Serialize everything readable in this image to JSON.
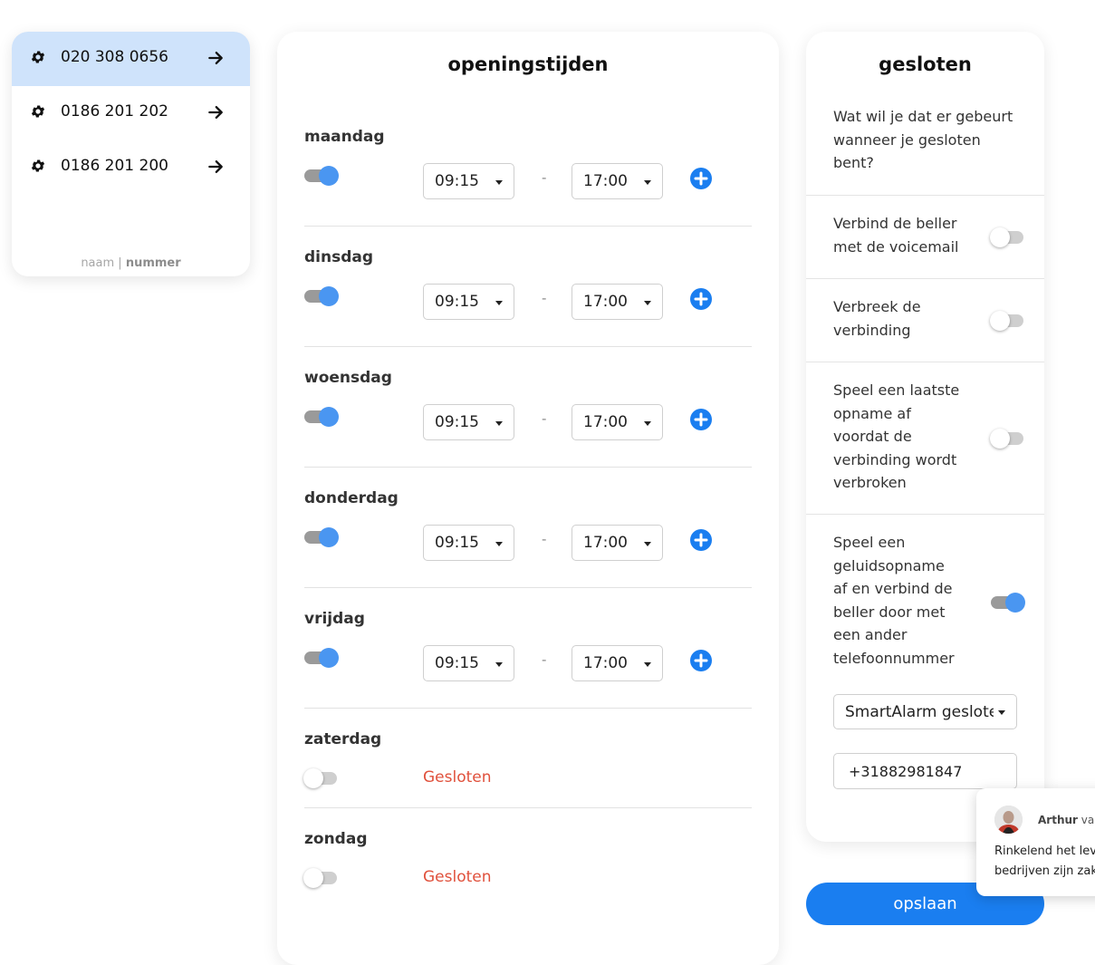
{
  "numbers": {
    "items": [
      {
        "number": "020 308 0656",
        "active": true
      },
      {
        "number": "0186 201 202",
        "active": false
      },
      {
        "number": "0186 201 200",
        "active": false
      }
    ],
    "sort_name": "naam",
    "sort_separator": "|",
    "sort_number": "nummer"
  },
  "hours": {
    "title": "openingstijden",
    "days": [
      {
        "name": "maandag",
        "open": true,
        "from": "09:15",
        "to": "17:00"
      },
      {
        "name": "dinsdag",
        "open": true,
        "from": "09:15",
        "to": "17:00"
      },
      {
        "name": "woensdag",
        "open": true,
        "from": "09:15",
        "to": "17:00"
      },
      {
        "name": "donderdag",
        "open": true,
        "from": "09:15",
        "to": "17:00"
      },
      {
        "name": "vrijdag",
        "open": true,
        "from": "09:15",
        "to": "17:00"
      },
      {
        "name": "zaterdag",
        "open": false,
        "status": "Gesloten"
      },
      {
        "name": "zondag",
        "open": false,
        "status": "Gesloten"
      }
    ],
    "range_separator": "-"
  },
  "closed": {
    "title": "gesloten",
    "question": [
      "Wat wil je dat er gebeurt",
      "wanneer je gesloten",
      "bent?"
    ],
    "options": [
      {
        "lines": [
          "Verbind de beller",
          "met de voicemail"
        ],
        "enabled": false
      },
      {
        "lines": [
          "Verbreek de",
          "verbinding"
        ],
        "enabled": false
      },
      {
        "lines": [
          "Speel een laatste",
          "opname af",
          "voordat de",
          "verbinding wordt",
          "verbroken"
        ],
        "enabled": false
      },
      {
        "lines": [
          "Speel een",
          "geluidsopname",
          "af en verbind de",
          "beller door met",
          "een ander",
          "telefoonnummer"
        ],
        "enabled": true
      }
    ],
    "recording_select": "SmartAlarm gesloten",
    "phone_value": "+31882981847"
  },
  "save_label": "opslaan",
  "chat": {
    "agent_name": "Arthur",
    "agent_suffix": "van",
    "message_lines": [
      "Rinkelend het leve",
      "bedrijven zijn zake"
    ]
  },
  "colors": {
    "accent": "#1a7ef0",
    "toggle_on": "#4a96f1",
    "active_row": "#cfe3fb",
    "closed_text": "#e0513c"
  }
}
